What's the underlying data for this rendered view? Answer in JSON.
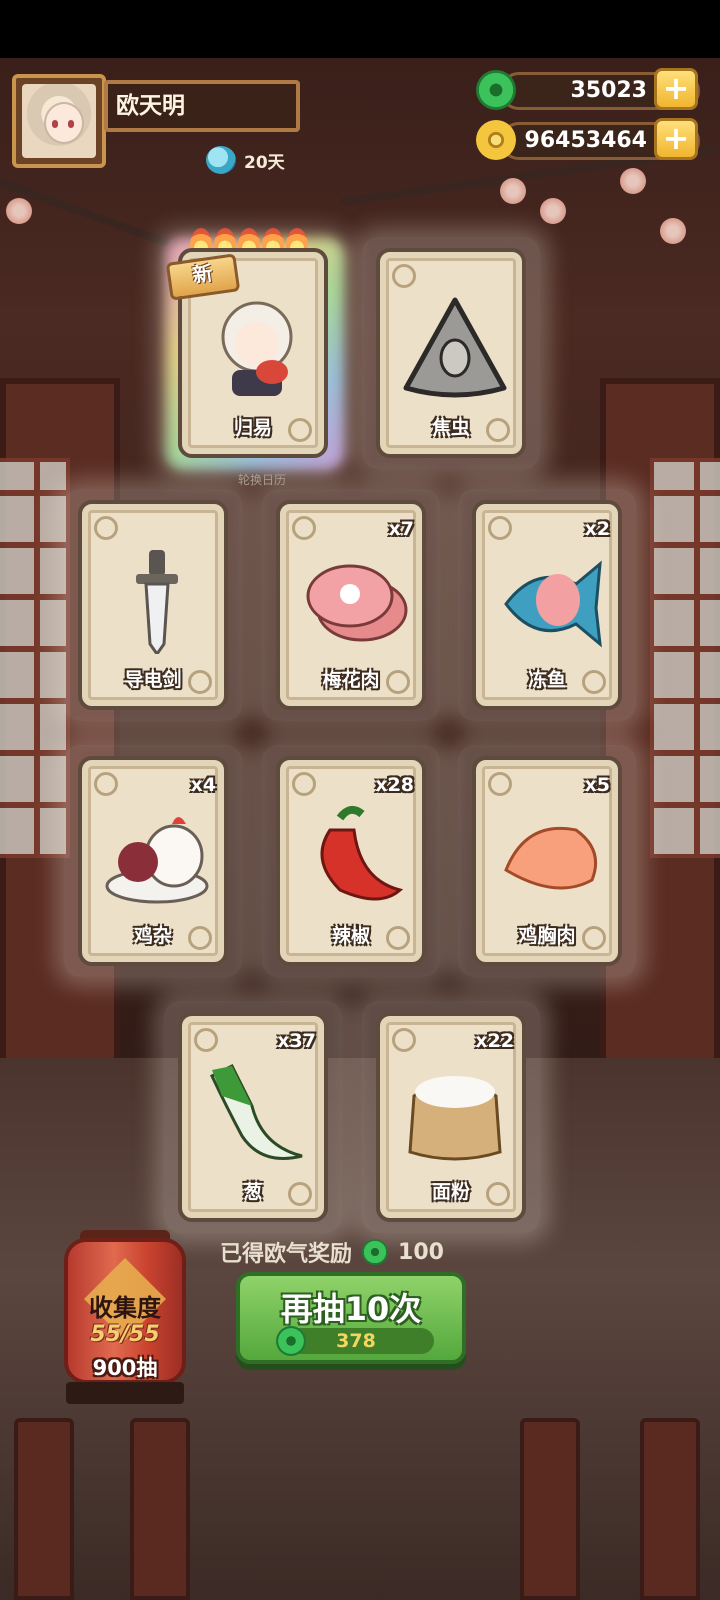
{
  "player": {
    "name": "欧天明",
    "days": "20天"
  },
  "resources": {
    "jade": "35023",
    "coins": "96453464"
  },
  "featured_caption": "轮换日历",
  "new_badge": "新",
  "cards": [
    {
      "label": "归易",
      "count": "",
      "icon": "character-icon"
    },
    {
      "label": "焦虫",
      "count": "",
      "icon": "bug-icon"
    },
    {
      "label": "导电剑",
      "count": "",
      "icon": "sword-icon"
    },
    {
      "label": "梅花肉",
      "count": "x7",
      "icon": "pork-icon"
    },
    {
      "label": "冻鱼",
      "count": "x2",
      "icon": "fish-icon"
    },
    {
      "label": "鸡杂",
      "count": "x4",
      "icon": "chicken-icon"
    },
    {
      "label": "辣椒",
      "count": "x28",
      "icon": "chili-icon"
    },
    {
      "label": "鸡胸肉",
      "count": "x5",
      "icon": "chicken-breast-icon"
    },
    {
      "label": "葱",
      "count": "x37",
      "icon": "scallion-icon"
    },
    {
      "label": "面粉",
      "count": "x22",
      "icon": "flour-icon"
    }
  ],
  "reward": {
    "text": "已得欧气奖励",
    "value": "100"
  },
  "redraw": {
    "label": "再抽10次",
    "cost": "378"
  },
  "collection": {
    "title": "收集度",
    "progress": "55/55",
    "draws": "900抽"
  },
  "colors": {
    "button_green": "#54a83c",
    "gold": "#f0b52f",
    "jade_green": "#3cc25a"
  }
}
